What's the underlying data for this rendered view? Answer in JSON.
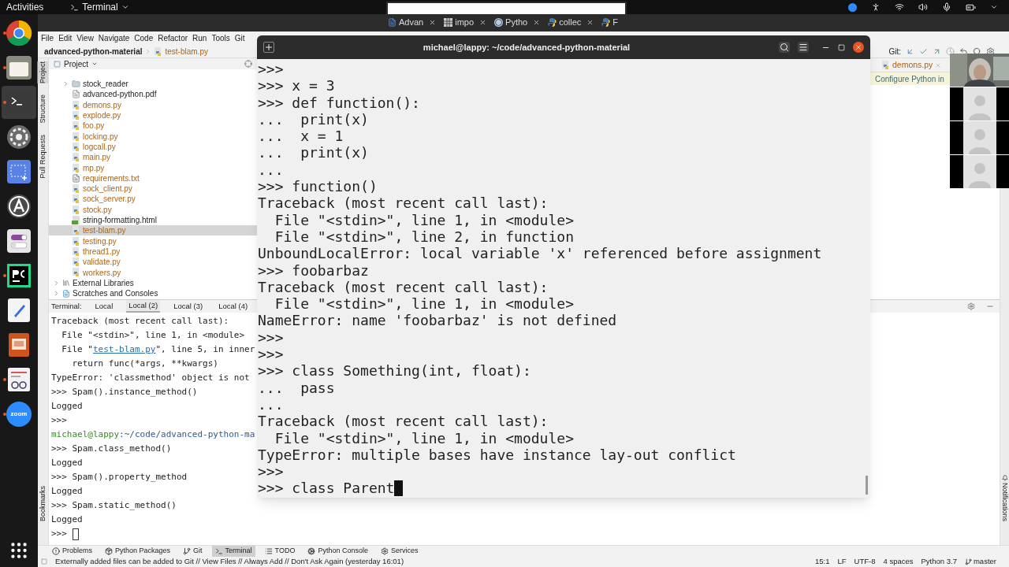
{
  "top_bar": {
    "activities": "Activities",
    "app_menu": "Terminal"
  },
  "dock": [
    {
      "kind": "browser",
      "running": true,
      "active": false
    },
    {
      "kind": "files",
      "running": true,
      "active": false
    },
    {
      "kind": "terminal",
      "running": true,
      "active": true
    },
    {
      "kind": "settings",
      "running": false,
      "active": false
    },
    {
      "kind": "screenshot",
      "running": false,
      "active": false
    },
    {
      "kind": "software",
      "running": false,
      "active": false
    },
    {
      "kind": "tweaks",
      "running": false,
      "active": false
    },
    {
      "kind": "pycharm",
      "running": true,
      "active": false
    },
    {
      "kind": "editor",
      "running": false,
      "active": false
    },
    {
      "kind": "slides",
      "running": false,
      "active": false
    },
    {
      "kind": "viewer",
      "running": true,
      "active": false
    },
    {
      "kind": "zoom",
      "running": true,
      "active": false,
      "label": "zoom"
    }
  ],
  "browser_tabs": [
    {
      "label": "Advan",
      "kind": "doc",
      "closable": true
    },
    {
      "label": "impo",
      "kind": "sheet",
      "closable": true
    },
    {
      "label": "Pytho",
      "kind": "wp",
      "closable": true
    },
    {
      "label": "collec",
      "kind": "python",
      "closable": true
    },
    {
      "label": "F",
      "kind": "python",
      "closable": false
    }
  ],
  "ide": {
    "menu": [
      "File",
      "Edit",
      "View",
      "Navigate",
      "Code",
      "Refactor",
      "Run",
      "Tools",
      "Git"
    ],
    "breadcrumb": {
      "project": "advanced-python-material",
      "file": "test-blam.py"
    },
    "git_toolbar": {
      "label": "Git:"
    },
    "side_strip": [
      {
        "label": "Project",
        "selected": true
      },
      {
        "label": "Structure",
        "selected": false
      },
      {
        "label": "Pull Requests",
        "selected": false
      }
    ],
    "bottom_strip": [
      "Bookmarks"
    ],
    "right_strip": [
      "Notifications"
    ],
    "project_panel": {
      "title": "Project",
      "items": [
        {
          "kind": "folder",
          "label": "stock_reader",
          "untracked": false,
          "selected": false
        },
        {
          "kind": "pdf",
          "label": "advanced-python.pdf",
          "untracked": false,
          "selected": false
        },
        {
          "kind": "py",
          "label": "demons.py",
          "untracked": true,
          "selected": false
        },
        {
          "kind": "py",
          "label": "explode.py",
          "untracked": true,
          "selected": false
        },
        {
          "kind": "py",
          "label": "foo.py",
          "untracked": true,
          "selected": false
        },
        {
          "kind": "py",
          "label": "locking.py",
          "untracked": true,
          "selected": false
        },
        {
          "kind": "py",
          "label": "logcall.py",
          "untracked": true,
          "selected": false
        },
        {
          "kind": "py",
          "label": "main.py",
          "untracked": true,
          "selected": false
        },
        {
          "kind": "py",
          "label": "mp.py",
          "untracked": true,
          "selected": false
        },
        {
          "kind": "txt",
          "label": "requirements.txt",
          "untracked": true,
          "selected": false
        },
        {
          "kind": "py",
          "label": "sock_client.py",
          "untracked": true,
          "selected": false
        },
        {
          "kind": "py",
          "label": "sock_server.py",
          "untracked": true,
          "selected": false
        },
        {
          "kind": "py",
          "label": "stock.py",
          "untracked": true,
          "selected": false
        },
        {
          "kind": "html",
          "label": "string-formatting.html",
          "untracked": false,
          "selected": false
        },
        {
          "kind": "py",
          "label": "test-blam.py",
          "untracked": true,
          "selected": true
        },
        {
          "kind": "py",
          "label": "testing.py",
          "untracked": true,
          "selected": false
        },
        {
          "kind": "py",
          "label": "thread1.py",
          "untracked": true,
          "selected": false
        },
        {
          "kind": "py",
          "label": "validate.py",
          "untracked": true,
          "selected": false
        },
        {
          "kind": "py",
          "label": "workers.py",
          "untracked": true,
          "selected": false
        }
      ],
      "roots": [
        {
          "kind": "libraries",
          "label": "External Libraries"
        },
        {
          "kind": "scratches",
          "label": "Scratches and Consoles"
        }
      ]
    },
    "editor_tab": {
      "label": "demons.py"
    },
    "banner": "Configure Python in",
    "terminal_panel": {
      "label": "Terminal:",
      "tabs": [
        {
          "label": "Local",
          "selected": false
        },
        {
          "label": "Local (2)",
          "selected": true
        },
        {
          "label": "Local (3)",
          "selected": false
        },
        {
          "label": "Local (4)",
          "selected": false
        }
      ],
      "lines": [
        {
          "kind": "plain",
          "text": "Traceback (most recent call last):"
        },
        {
          "kind": "plain",
          "text": "  File \"<stdin>\", line 1, in <module>"
        },
        {
          "kind": "link",
          "before": "  File \"",
          "link": "test-blam.py",
          "after": "\", line 5, in inner"
        },
        {
          "kind": "plain",
          "text": "    return func(*args, **kwargs)"
        },
        {
          "kind": "plain",
          "text": "TypeError: 'classmethod' object is not"
        },
        {
          "kind": "plain",
          "text": ">>> Spam().instance_method()"
        },
        {
          "kind": "plain",
          "text": "Logged"
        },
        {
          "kind": "plain",
          "text": ">>>"
        },
        {
          "kind": "prompt",
          "user": "michael@lappy",
          "path": ":~/code/advanced-python-ma"
        },
        {
          "kind": "plain",
          "text": ">>> Spam.class_method()"
        },
        {
          "kind": "plain",
          "text": "Logged"
        },
        {
          "kind": "plain",
          "text": ">>> Spam().property_method"
        },
        {
          "kind": "plain",
          "text": "Logged"
        },
        {
          "kind": "plain",
          "text": ">>> Spam.static_method()"
        },
        {
          "kind": "plain",
          "text": "Logged"
        },
        {
          "kind": "cursor",
          "text": ">>>"
        }
      ]
    },
    "tool_tabs": [
      {
        "kind": "problems",
        "label": "Problems",
        "selected": false
      },
      {
        "kind": "packages",
        "label": "Python Packages",
        "selected": false
      },
      {
        "kind": "git",
        "label": "Git",
        "selected": false
      },
      {
        "kind": "terminal",
        "label": "Terminal",
        "selected": true
      },
      {
        "kind": "todo",
        "label": "TODO",
        "selected": false
      },
      {
        "kind": "console",
        "label": "Python Console",
        "selected": false
      },
      {
        "kind": "services",
        "label": "Services",
        "selected": false
      }
    ],
    "status_bar": {
      "message": "Externally added files can be added to Git // View Files // Always Add // Don't Ask Again (yesterday 16:01)",
      "items": [
        "15:1",
        "LF",
        "UTF-8",
        "4 spaces",
        "Python 3.7"
      ],
      "branch": "master"
    }
  },
  "terminal_window": {
    "title": "michael@lappy: ~/code/advanced-python-material",
    "lines": [
      ">>>",
      ">>> x = 3",
      ">>> def function():",
      "...  print(x)",
      "...  x = 1",
      "...  print(x)",
      "...",
      ">>> function()",
      "Traceback (most recent call last):",
      "  File \"<stdin>\", line 1, in <module>",
      "  File \"<stdin>\", line 2, in function",
      "UnboundLocalError: local variable 'x' referenced before assignment",
      ">>> foobarbaz",
      "Traceback (most recent call last):",
      "  File \"<stdin>\", line 1, in <module>",
      "NameError: name 'foobarbaz' is not defined",
      ">>>",
      ">>>",
      ">>> class Something(int, float):",
      "...  pass",
      "...",
      "Traceback (most recent call last):",
      "  File \"<stdin>\", line 1, in <module>",
      "TypeError: multiple bases have instance lay-out conflict",
      ">>>"
    ],
    "input": ">>> class Parent"
  },
  "video_call": {
    "tiles": [
      {
        "kind": "video"
      },
      {
        "kind": "avatar"
      },
      {
        "kind": "avatar"
      },
      {
        "kind": "avatar"
      }
    ]
  }
}
